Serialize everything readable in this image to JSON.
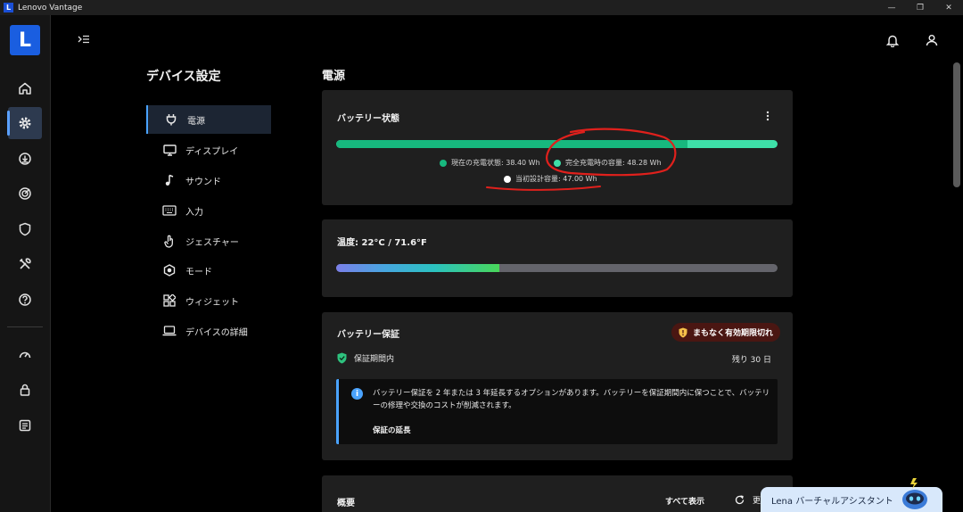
{
  "window": {
    "app_icon_letter": "L",
    "title": "Lenovo Vantage",
    "controls": {
      "minimize": "—",
      "maximize": "❐",
      "close": "✕"
    }
  },
  "rail": {
    "logo": "L",
    "items": [
      {
        "name": "home-icon"
      },
      {
        "name": "gear-icon",
        "active": true
      },
      {
        "name": "download-icon"
      },
      {
        "name": "radar-icon"
      },
      {
        "name": "shield-icon"
      },
      {
        "name": "tools-icon"
      },
      {
        "name": "help-icon"
      },
      {
        "name": "speedometer-icon"
      },
      {
        "name": "lock-icon"
      },
      {
        "name": "app-icon"
      }
    ]
  },
  "nav": {
    "title": "デバイス設定",
    "items": [
      {
        "label": "電源",
        "icon": "power-plug-icon",
        "active": true
      },
      {
        "label": "ディスプレイ",
        "icon": "monitor-icon"
      },
      {
        "label": "サウンド",
        "icon": "music-note-icon"
      },
      {
        "label": "入力",
        "icon": "keyboard-icon"
      },
      {
        "label": "ジェスチャー",
        "icon": "gesture-hand-icon"
      },
      {
        "label": "モード",
        "icon": "mode-hexagon-icon"
      },
      {
        "label": "ウィジェット",
        "icon": "widget-grid-icon"
      },
      {
        "label": "デバイスの詳細",
        "icon": "laptop-icon"
      }
    ]
  },
  "main": {
    "section_title": "電源",
    "battery_status": {
      "title": "バッテリー状態",
      "current_charge_label": "現在の充電状態: 38.40 Wh",
      "full_capacity_label": "完全充電時の容量: 48.28 Wh",
      "design_capacity_label": "当初設計容量: 47.00 Wh",
      "current_charge_wh": 38.4,
      "full_capacity_wh": 48.28,
      "design_capacity_wh": 47.0,
      "colors": {
        "current": "#17b87e",
        "full": "#3ee0a8",
        "design": "#ffffff"
      }
    },
    "temperature": {
      "title": "温度: 22°C / 71.6°F",
      "level_fraction": 0.37
    },
    "battery_warranty": {
      "title": "バッテリー保証",
      "badge": "まもなく有効期限切れ",
      "status_label": "保証期間内",
      "remaining": "残り 30 日",
      "info_text": "バッテリー保証を 2 年または 3 年延長するオプションがあります。バッテリーを保証期間内に保つことで、バッテリーの修理や交換のコストが削減されます。",
      "extend_link": "保証の延長"
    },
    "overview": {
      "title": "概要",
      "show_all": "すべて表示",
      "refresh_label": "更"
    }
  },
  "assistant": {
    "label": "Lena バーチャルアシスタント"
  }
}
